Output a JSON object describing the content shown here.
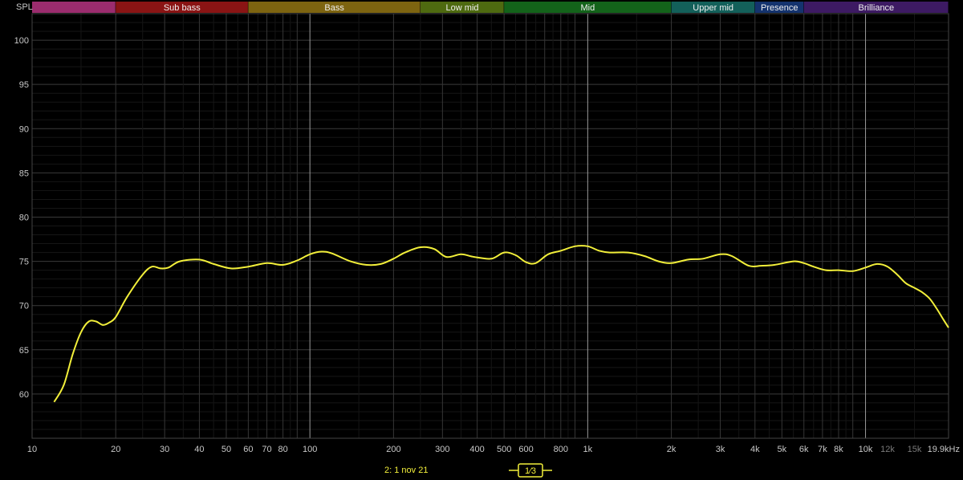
{
  "chart_data": {
    "type": "line",
    "ylabel": "SPL",
    "xunit": "Hz",
    "x_scale": "log",
    "xlim": [
      10,
      19900
    ],
    "ylim": [
      55,
      103
    ],
    "grid": true,
    "y_ticks": [
      60,
      65,
      70,
      75,
      80,
      85,
      90,
      95,
      100
    ],
    "x_tick_labels": [
      {
        "v": 10,
        "t": "10"
      },
      {
        "v": 20,
        "t": "20"
      },
      {
        "v": 30,
        "t": "30"
      },
      {
        "v": 40,
        "t": "40"
      },
      {
        "v": 50,
        "t": "50"
      },
      {
        "v": 60,
        "t": "60"
      },
      {
        "v": 70,
        "t": "70"
      },
      {
        "v": 80,
        "t": "80"
      },
      {
        "v": 100,
        "t": "100"
      },
      {
        "v": 200,
        "t": "200"
      },
      {
        "v": 300,
        "t": "300"
      },
      {
        "v": 400,
        "t": "400"
      },
      {
        "v": 500,
        "t": "500"
      },
      {
        "v": 600,
        "t": "600"
      },
      {
        "v": 800,
        "t": "800"
      },
      {
        "v": 1000,
        "t": "1k"
      },
      {
        "v": 2000,
        "t": "2k"
      },
      {
        "v": 3000,
        "t": "3k"
      },
      {
        "v": 4000,
        "t": "4k"
      },
      {
        "v": 5000,
        "t": "5k"
      },
      {
        "v": 6000,
        "t": "6k"
      },
      {
        "v": 7000,
        "t": "7k"
      },
      {
        "v": 8000,
        "t": "8k"
      },
      {
        "v": 10000,
        "t": "10k"
      },
      {
        "v": 12000,
        "t": "12k",
        "dim": true
      },
      {
        "v": 15000,
        "t": "15k",
        "dim": true
      },
      {
        "v": 19900,
        "t": "19.9kHz"
      }
    ],
    "bands": [
      {
        "name": "",
        "from": 10,
        "to": 20,
        "color": "#9b2c6e"
      },
      {
        "name": "Sub bass",
        "from": 20,
        "to": 60,
        "color": "#8a1414"
      },
      {
        "name": "Bass",
        "from": 60,
        "to": 250,
        "color": "#7d6410"
      },
      {
        "name": "Low mid",
        "from": 250,
        "to": 500,
        "color": "#4e6a10"
      },
      {
        "name": "Mid",
        "from": 500,
        "to": 2000,
        "color": "#13631a"
      },
      {
        "name": "Upper mid",
        "from": 2000,
        "to": 4000,
        "color": "#13605a"
      },
      {
        "name": "Presence",
        "from": 4000,
        "to": 6000,
        "color": "#14336e"
      },
      {
        "name": "Brilliance",
        "from": 6000,
        "to": 19900,
        "color": "#3d1a63"
      }
    ],
    "series": [
      {
        "color": "#f2ef3a",
        "points": [
          [
            12,
            59.1
          ],
          [
            13,
            61
          ],
          [
            14,
            64.5
          ],
          [
            15,
            67
          ],
          [
            16,
            68.2
          ],
          [
            17,
            68.2
          ],
          [
            18,
            67.8
          ],
          [
            19,
            68.1
          ],
          [
            20,
            68.7
          ],
          [
            22,
            71
          ],
          [
            25,
            73.5
          ],
          [
            27,
            74.4
          ],
          [
            29,
            74.2
          ],
          [
            31,
            74.3
          ],
          [
            34,
            75
          ],
          [
            40,
            75.2
          ],
          [
            45,
            74.7
          ],
          [
            52,
            74.2
          ],
          [
            60,
            74.4
          ],
          [
            70,
            74.8
          ],
          [
            80,
            74.6
          ],
          [
            90,
            75.1
          ],
          [
            100,
            75.8
          ],
          [
            110,
            76.1
          ],
          [
            120,
            75.9
          ],
          [
            140,
            75
          ],
          [
            160,
            74.6
          ],
          [
            180,
            74.7
          ],
          [
            200,
            75.3
          ],
          [
            220,
            76
          ],
          [
            250,
            76.6
          ],
          [
            280,
            76.4
          ],
          [
            310,
            75.5
          ],
          [
            350,
            75.8
          ],
          [
            390,
            75.5
          ],
          [
            450,
            75.3
          ],
          [
            500,
            76
          ],
          [
            550,
            75.7
          ],
          [
            600,
            74.9
          ],
          [
            650,
            74.8
          ],
          [
            720,
            75.8
          ],
          [
            800,
            76.2
          ],
          [
            900,
            76.7
          ],
          [
            1000,
            76.7
          ],
          [
            1100,
            76.2
          ],
          [
            1200,
            76
          ],
          [
            1400,
            76
          ],
          [
            1600,
            75.6
          ],
          [
            1800,
            75
          ],
          [
            2000,
            74.8
          ],
          [
            2300,
            75.2
          ],
          [
            2600,
            75.3
          ],
          [
            3000,
            75.8
          ],
          [
            3300,
            75.6
          ],
          [
            3800,
            74.5
          ],
          [
            4200,
            74.5
          ],
          [
            4700,
            74.6
          ],
          [
            5500,
            75
          ],
          [
            6000,
            74.8
          ],
          [
            6500,
            74.4
          ],
          [
            7200,
            74
          ],
          [
            8000,
            74
          ],
          [
            9000,
            73.9
          ],
          [
            10000,
            74.3
          ],
          [
            11000,
            74.7
          ],
          [
            12000,
            74.4
          ],
          [
            13000,
            73.5
          ],
          [
            14000,
            72.5
          ],
          [
            15000,
            72
          ],
          [
            16000,
            71.5
          ],
          [
            17000,
            70.8
          ],
          [
            18000,
            69.7
          ],
          [
            19000,
            68.5
          ],
          [
            19900,
            67.5
          ]
        ]
      }
    ]
  },
  "footer": {
    "measurement_label": "2: 1 nov 21",
    "smoothing_label": "1⁄3",
    "colors": {
      "measurement": "#f2ef3a",
      "smoothing": "#f2ef3a"
    }
  }
}
